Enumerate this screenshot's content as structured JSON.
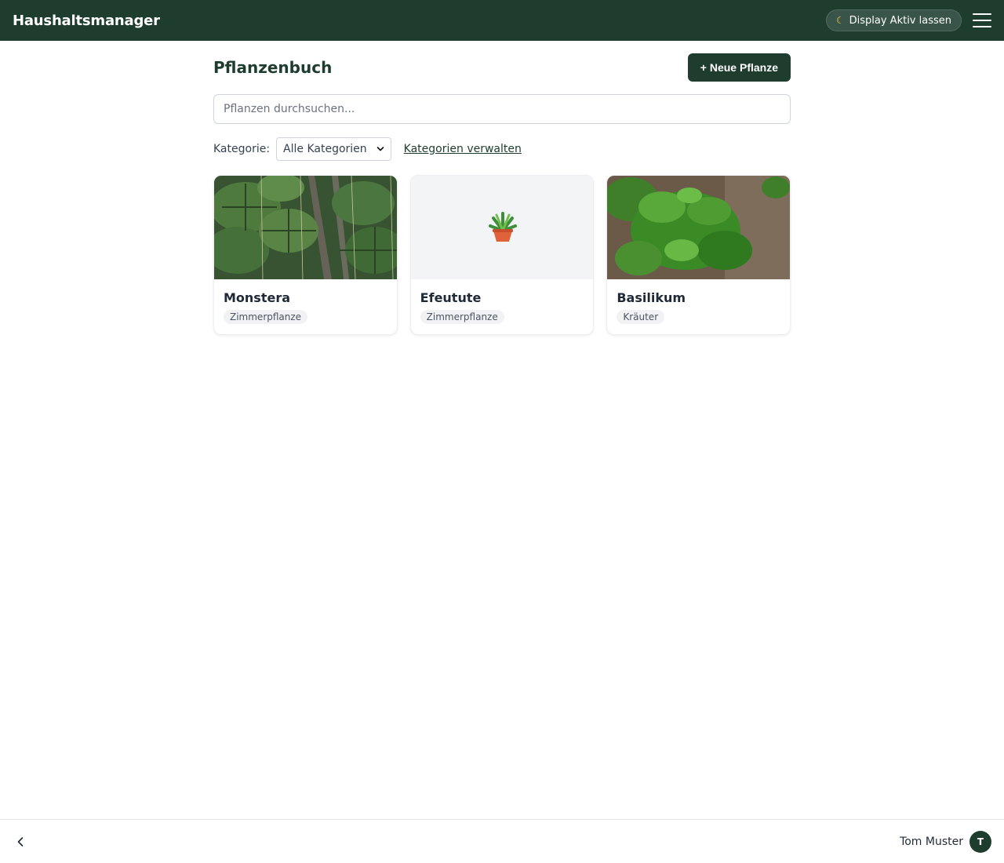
{
  "header": {
    "app_title": "Haushaltsmanager",
    "display_button_label": "Display Aktiv lassen",
    "display_icon": "moon-icon",
    "menu_icon": "hamburger-menu-icon"
  },
  "page": {
    "title": "Pflanzenbuch",
    "new_button_label": "+ Neue Pflanze",
    "search_placeholder": "Pflanzen durchsuchen...",
    "filter": {
      "label": "Kategorie:",
      "selected": "Alle Kategorien",
      "manage_link": "Kategorien verwalten"
    }
  },
  "plants": [
    {
      "name": "Monstera",
      "category": "Zimmerpflanze",
      "image": "monstera-photo"
    },
    {
      "name": "Efeutute",
      "category": "Zimmerpflanze",
      "image": "potted-plant-icon"
    },
    {
      "name": "Basilikum",
      "category": "Kräuter",
      "image": "basil-photo"
    }
  ],
  "footer": {
    "back_icon": "chevron-left-icon",
    "user_name": "Tom Muster",
    "avatar_initial": "T"
  },
  "colors": {
    "brand": "#1e3d2f",
    "background": "#ffffff",
    "placeholder_bg": "#f3f4f6"
  }
}
